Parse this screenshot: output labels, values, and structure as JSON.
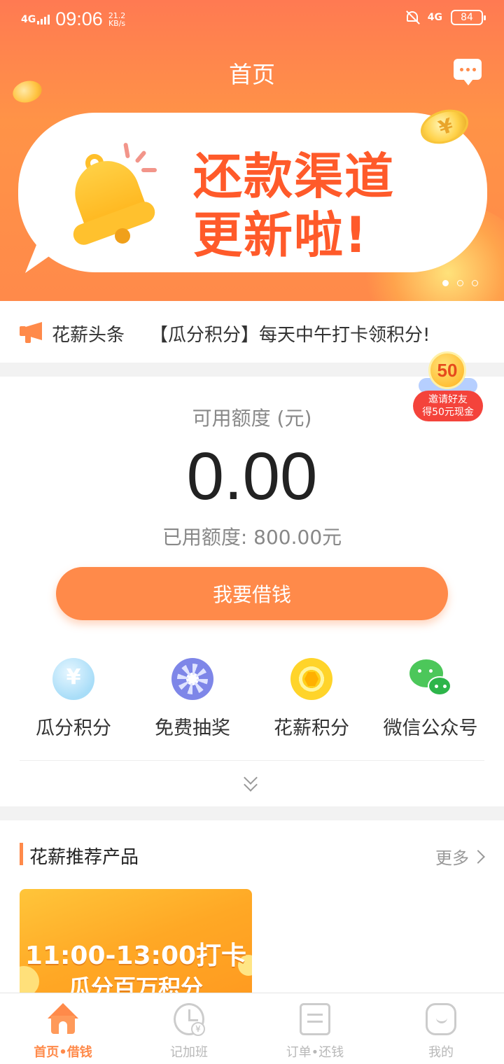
{
  "status_bar": {
    "network_left": "4G",
    "time": "09:06",
    "speed_value": "21.2",
    "speed_unit": "KB/s",
    "network_right": "4G",
    "battery": "84"
  },
  "header": {
    "title": "首页"
  },
  "banner": {
    "line1": "还款渠道",
    "line2": "更新啦!",
    "slides": 3,
    "active_slide": 1
  },
  "ticker": {
    "label": "花薪头条",
    "text": "【瓜分积分】每天中午打卡领积分!"
  },
  "credit": {
    "available_label": "可用额度 (元)",
    "available_value": "0.00",
    "used_text": "已用额度: 800.00元",
    "borrow_button": "我要借钱"
  },
  "invite": {
    "badge": "50",
    "line1": "邀请好友",
    "line2": "得50元现金"
  },
  "features": [
    {
      "label": "瓜分积分",
      "icon": "yuan-droplet-icon"
    },
    {
      "label": "免费抽奖",
      "icon": "lottery-wheel-icon"
    },
    {
      "label": "花薪积分",
      "icon": "points-coin-icon"
    },
    {
      "label": "微信公众号",
      "icon": "wechat-icon"
    }
  ],
  "recommend": {
    "title": "花薪推荐产品",
    "more": "更多",
    "promo_line1": "11:00-13:00打卡",
    "promo_line2": "瓜分百万积分"
  },
  "tabbar": [
    {
      "label": "首页•借钱",
      "active": true
    },
    {
      "label": "记加班",
      "active": false
    },
    {
      "label": "订单•还钱",
      "active": false
    },
    {
      "label": "我的",
      "active": false
    }
  ],
  "colors": {
    "accent": "#ff8a4a",
    "banner_text": "#ff5a2a",
    "invite_red": "#f4433b"
  }
}
